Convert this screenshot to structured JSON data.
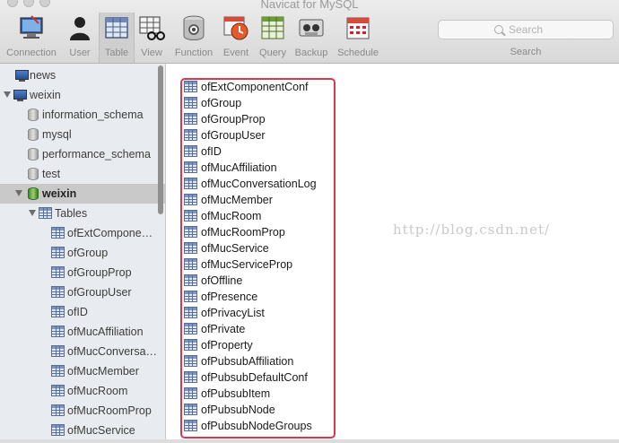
{
  "window": {
    "title": "Navicat for MySQL"
  },
  "toolbar": {
    "buttons": [
      {
        "label": "Connection",
        "icon": "connection-icon"
      },
      {
        "label": "User",
        "icon": "user-icon"
      },
      {
        "label": "Table",
        "icon": "table-icon",
        "active": true
      },
      {
        "label": "View",
        "icon": "view-icon"
      },
      {
        "label": "Function",
        "icon": "function-icon"
      },
      {
        "label": "Event",
        "icon": "event-icon"
      },
      {
        "label": "Query",
        "icon": "query-icon"
      },
      {
        "label": "Backup",
        "icon": "backup-icon"
      },
      {
        "label": "Schedule",
        "icon": "schedule-icon"
      }
    ],
    "search": {
      "placeholder": "Search",
      "label": "Search"
    }
  },
  "sidebar": {
    "connections": [
      {
        "name": "news",
        "icon": "connection-icon"
      },
      {
        "name": "weixin",
        "icon": "connection-icon",
        "expanded": true
      }
    ],
    "databases": [
      "information_schema",
      "mysql",
      "performance_schema",
      "test",
      "weixin"
    ],
    "selected_database": "weixin",
    "tables_group": "Tables",
    "tables": [
      "ofExtComponentConf",
      "ofGroup",
      "ofGroupProp",
      "ofGroupUser",
      "ofID",
      "ofMucAffiliation",
      "ofMucConversationLog",
      "ofMucMember",
      "ofMucRoom",
      "ofMucRoomProp",
      "ofMucService"
    ],
    "truncated_labels": [
      "ofExtCompone…",
      "ofGroup",
      "ofGroupProp",
      "ofGroupUser",
      "ofID",
      "ofMucAffiliation",
      "ofMucConversa…",
      "ofMucMember",
      "ofMucRoom",
      "ofMucRoomProp",
      "ofMucService"
    ]
  },
  "main": {
    "tables": [
      "ofExtComponentConf",
      "ofGroup",
      "ofGroupProp",
      "ofGroupUser",
      "ofID",
      "ofMucAffiliation",
      "ofMucConversationLog",
      "ofMucMember",
      "ofMucRoom",
      "ofMucRoomProp",
      "ofMucService",
      "ofMucServiceProp",
      "ofOffline",
      "ofPresence",
      "ofPrivacyList",
      "ofPrivate",
      "ofProperty",
      "ofPubsubAffiliation",
      "ofPubsubDefaultConf",
      "ofPubsubItem",
      "ofPubsubNode",
      "ofPubsubNodeGroups"
    ],
    "highlight_color": "#d33a52"
  },
  "watermark": "http://blog.csdn.net/"
}
